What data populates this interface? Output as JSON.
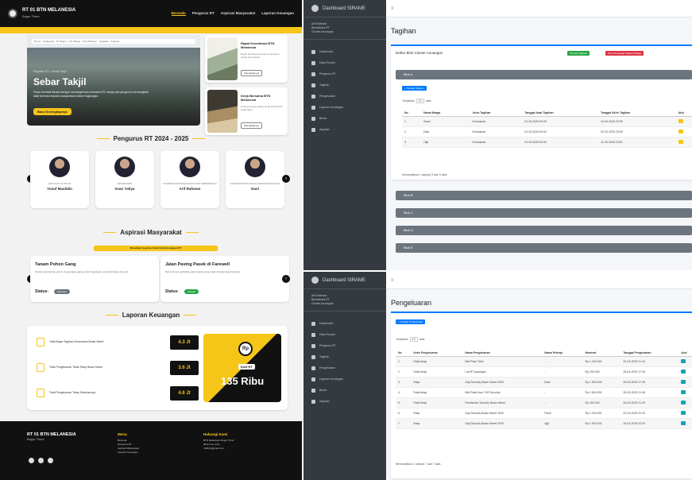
{
  "site": {
    "brand": "RT 01 BTN MELANESIA",
    "brand_sub": "Bogor Timur",
    "nav": [
      "Beranda",
      "Pengurus RT",
      "Aspirasi Masyarakat",
      "Laporan Keuangan"
    ],
    "hero": {
      "url_text": "Rw 01 · Pelayanan · RT Bogor · Info Warga · Iuran Bulanan · Kegiatan · Aspirasi",
      "breadcrumb": "Kegiatan RT > Sebar Takjil",
      "title": "Sebar Takjil",
      "desc": "Pasar kembali dibuka dengan semangat baru bersama RT, warga dan pengurus membagikan takjil berbuka kepada masyarakat sekitar lingkungan.",
      "button": "Baca Selengkapnya"
    },
    "news": [
      {
        "title": "Rapat Koordinasi BTN Melanesia",
        "desc": "Rapat koordinasi pengurus bersama warga perumahan.",
        "button": "Selengkapnya"
      },
      {
        "title": "Kerja Bersama BTN Melanesia",
        "desc": "Gotong royong warga untuk kebersihan lingkungan.",
        "button": "Selengkapnya"
      }
    ],
    "pengurus_title": "Pengurus RT 2024 - 2025",
    "pengurus": [
      {
        "role": "KETUA RT 01 RW 06",
        "name": "Yusuf Maulidin"
      },
      {
        "role": "SEKRETARIS",
        "name": "Irvan Yahya"
      },
      {
        "role": "KOORDINATOR KEAMANAN DAN KEBERSIHAN",
        "name": "Arif Rahman"
      },
      {
        "role": "KOORDINATOR SOSIAL KEMASYARAKATAN",
        "name": "Dani"
      }
    ],
    "aspirasi_title": "Aspirasi Masyarakat",
    "aspirasi_cta": "Masukkan Aspirasi Anda Untuk Kemajuan RT",
    "aspirasi": [
      {
        "title": "Tanam Pohon Gang",
        "desc": "Usulan penanaman pohon di sepanjang gang untuk lingkungan yang lebih hijau dan asri.",
        "status_label": "Status:",
        "status": "Diproses",
        "color": "#6c757d"
      },
      {
        "title": "Jalan Paving Pasek di Farewell",
        "desc": "Permohonan perbaikan jalan paving yang rusak di dekat area Farewell.",
        "status_label": "Status:",
        "status": "Selesai",
        "color": "#28a745"
      }
    ],
    "keuangan_title": "Laporan Keuangan",
    "keuangan": [
      {
        "label": "Total Bayar Tagihan Keamanan Bulan Maret",
        "value": "4.3 Jt"
      },
      {
        "label": "Total Pengeluaran Tidak Tetap Bulan Maret",
        "value": "3.6 Jt"
      },
      {
        "label": "Total Pengeluaran Tetap Sebelumnya",
        "value": "4.6 Jt"
      }
    ],
    "kas": {
      "symbol": "Rp",
      "label": "KAS RT",
      "amount": "135 Ribu"
    },
    "footer": {
      "brand": "RT 01 BTN MELANESIA",
      "sub": "Bogor Timur",
      "menu_title": "Menu",
      "menu": [
        "Beranda",
        "Pengurus RT",
        "Aspirasi Masyarakat",
        "Laporan Keuangan"
      ],
      "contact_title": "Hubungi Kami",
      "contact": [
        "BTN Melanesia, Bogor Timur",
        "0812-xxxx-xxxx",
        "rt01btn@gmail.com"
      ]
    }
  },
  "admin_common": {
    "brand": "Dashboard SIRAME",
    "user": [
      "Arif Rahman",
      "Bendahara RT",
      "Cluster Anuangan"
    ],
    "menu": [
      "Dashboard",
      "Data Rumah",
      "Pengurus RT",
      "Tagihan",
      "Pengeluaran",
      "Laporan Keuangan",
      "Berita",
      "Aspirasi"
    ]
  },
  "tagihan": {
    "page_title": "Tagihan",
    "card_title": "Daftar Blok Cluster Anuangan",
    "btn_green": "Tambah Tagihan",
    "btn_red": "Kirim Pengingat Tagihan Warga",
    "blok_open": "Blok A",
    "btn_add": "+ Tambah Tagihan",
    "show_entries": [
      "Tampilkan",
      "10",
      "data"
    ],
    "columns": [
      "No",
      "Nama Warga",
      "Jenis Tagihan",
      "Tanggal Awal Tagihan",
      "Tanggal Akhir Tagihan",
      "Aksi"
    ],
    "rows": [
      [
        "1",
        "Ikram",
        "Keamanan",
        "01-03-2025 00:00",
        "10-04-2025 23:59"
      ],
      [
        "2",
        "Dian",
        "Keamanan",
        "01-03-2025 00:00",
        "30-03-2025 23:59"
      ],
      [
        "3",
        "Ojik",
        "Keamanan",
        "01-03-2025 00:00",
        "11-03-2025 23:59"
      ]
    ],
    "footer": "Menampilkan 1 sampai 3 dari 3 data",
    "blok_closed": [
      "Blok B",
      "Blok C",
      "Blok D",
      "Blok E"
    ]
  },
  "pengeluaran": {
    "page_title": "Pengeluaran",
    "btn_add": "+ Tambah Pengeluaran",
    "show_entries": [
      "Tampilkan",
      "10",
      "data"
    ],
    "columns": [
      "No",
      "Jenis Pengeluaran",
      "Nama Pengeluaran",
      "Nama Pekerja",
      "Nominal",
      "Tanggal Pengeluaran",
      "Aksi"
    ],
    "rows": [
      [
        "1",
        "Tidak tetap",
        "Beli Pasir Tiber",
        "-",
        "Rp 1.200.000",
        "20-03-2025 21:10"
      ],
      [
        "2",
        "Tidak tetap",
        "Cat RT lapangan",
        "-",
        "Rp 200.000",
        "25-03-2025 17:05"
      ],
      [
        "3",
        "Tetap",
        "Gaji Security Bulan Maret 2025",
        "Dani",
        "Rp 1.500.000",
        "25-03-2025 17:28"
      ],
      [
        "4",
        "Tidak tetap",
        "Beli Paket dan THR Security",
        "-",
        "Rp 1.500.000",
        "25-03-2025 21:08"
      ],
      [
        "5",
        "Tidak tetap",
        "Pemberian Security Bulan Maret",
        "-",
        "Rp 200.000",
        "26-03-2025 21:09"
      ],
      [
        "6",
        "Tetap",
        "Gaji Security Bulan Maret 2025",
        "Pardi",
        "Rp 1.200.000",
        "22-03-2025 22:00"
      ],
      [
        "7",
        "Tetap",
        "Gaji Security Bulan Maret 2025",
        "Agil",
        "Rp 1.500.000",
        "26-03-2025 22:00"
      ]
    ],
    "footer": "Menampilkan 1 sampai 7 dari 7 data"
  },
  "colors": {
    "accent": "#f5c518",
    "dark": "#111111",
    "sidebar": "#343a40",
    "primary": "#007bff"
  }
}
